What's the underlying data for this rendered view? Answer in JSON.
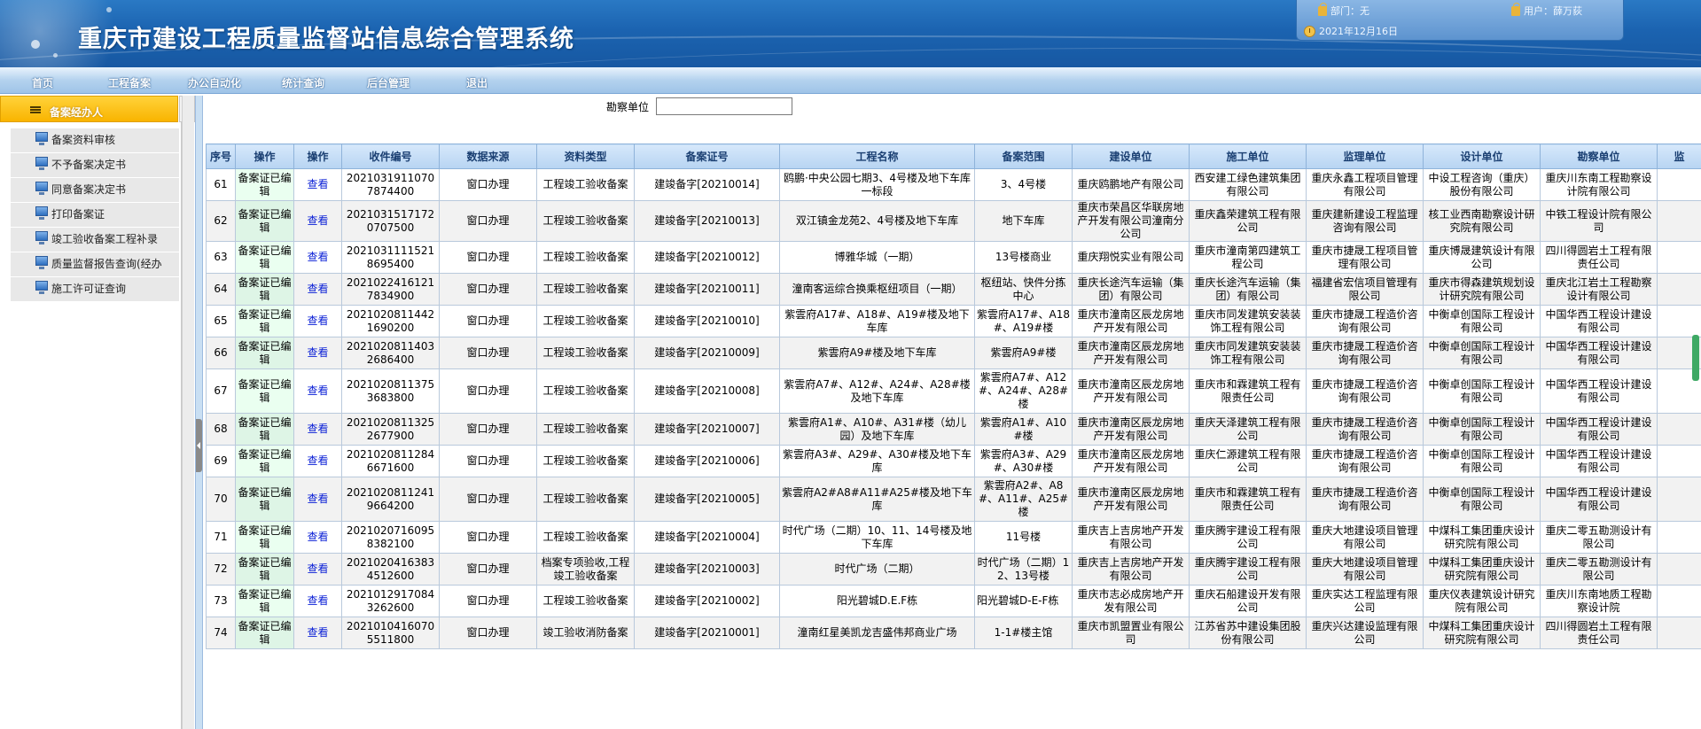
{
  "header": {
    "title": "重庆市建设工程质量监督站信息综合管理系统",
    "dept": "部门：无",
    "user": "用户：薛万荻",
    "date": "2021年12月16日"
  },
  "nav": [
    "首页",
    "工程备案",
    "办公自动化",
    "统计查询",
    "后台管理",
    "退出"
  ],
  "sidebar": {
    "header": "备案经办人",
    "items": [
      "备案资料审核",
      "不予备案决定书",
      "同意备案决定书",
      "打印备案证",
      "竣工验收备案工程补录",
      "质量监督报告查询(经办",
      "施工许可证查询"
    ]
  },
  "search": {
    "label": "勘察单位",
    "value": ""
  },
  "table": {
    "headers": [
      "序号",
      "操作",
      "操作",
      "收件编号",
      "数据来源",
      "资料类型",
      "备案证号",
      "工程名称",
      "备案范围",
      "建设单位",
      "施工单位",
      "监理单位",
      "设计单位",
      "勘察单位",
      "监"
    ],
    "rows": [
      [
        "61",
        "备案证已编辑",
        "查看",
        "20210319110707874400",
        "窗口办理",
        "工程竣工验收备案",
        "建竣备字[20210014]",
        "鸥鹏·中央公园七期3、4号楼及地下车库一标段",
        "3、4号楼",
        "重庆鸥鹏地产有限公司",
        "西安建工绿色建筑集团有限公司",
        "重庆永鑫工程项目管理有限公司",
        "中设工程咨询（重庆）股份有限公司",
        "重庆川东南工程勘察设计院有限公司"
      ],
      [
        "62",
        "备案证已编辑",
        "查看",
        "20210315171720707500",
        "窗口办理",
        "工程竣工验收备案",
        "建竣备字[20210013]",
        "双江镇金龙苑2、4号楼及地下车库",
        "地下车库",
        "重庆市荣昌区华联房地产开发有限公司潼南分公司",
        "重庆鑫荣建筑工程有限公司",
        "重庆建新建设工程监理咨询有限公司",
        "核工业西南勘察设计研究院有限公司",
        "中铁工程设计院有限公司"
      ],
      [
        "63",
        "备案证已编辑",
        "查看",
        "20210311115218695400",
        "窗口办理",
        "工程竣工验收备案",
        "建竣备字[20210012]",
        "博雅华城（一期）",
        "13号楼商业",
        "重庆翔悦实业有限公司",
        "重庆市潼南第四建筑工程公司",
        "重庆市捷晟工程项目管理有限公司",
        "重庆博晟建筑设计有限公司",
        "四川得圆岩土工程有限责任公司"
      ],
      [
        "64",
        "备案证已编辑",
        "查看",
        "20210224161217834900",
        "窗口办理",
        "工程竣工验收备案",
        "建竣备字[20210011]",
        "潼南客运综合换乘枢纽项目（一期）",
        "枢纽站、快件分拣中心",
        "重庆长途汽车运输（集团）有限公司",
        "重庆长途汽车运输（集团）有限公司",
        "福建省宏信项目管理有限公司",
        "重庆市得森建筑规划设计研究院有限公司",
        "重庆北江岩土工程勘察设计有限公司"
      ],
      [
        "65",
        "备案证已编辑",
        "查看",
        "20210208114421690200",
        "窗口办理",
        "工程竣工验收备案",
        "建竣备字[20210010]",
        "紫雲府A17#、A18#、A19#楼及地下车库",
        "紫雲府A17#、A18#、A19#楼",
        "重庆市潼南区辰龙房地产开发有限公司",
        "重庆市同发建筑安装装饰工程有限公司",
        "重庆市捷晟工程造价咨询有限公司",
        "中衡卓创国际工程设计有限公司",
        "中国华西工程设计建设有限公司"
      ],
      [
        "66",
        "备案证已编辑",
        "查看",
        "20210208114032686400",
        "窗口办理",
        "工程竣工验收备案",
        "建竣备字[20210009]",
        "紫雲府A9#楼及地下车库",
        "紫雲府A9#楼",
        "重庆市潼南区辰龙房地产开发有限公司",
        "重庆市同发建筑安装装饰工程有限公司",
        "重庆市捷晟工程造价咨询有限公司",
        "中衡卓创国际工程设计有限公司",
        "中国华西工程设计建设有限公司"
      ],
      [
        "67",
        "备案证已编辑",
        "查看",
        "20210208113753683800",
        "窗口办理",
        "工程竣工验收备案",
        "建竣备字[20210008]",
        "紫雲府A7#、A12#、A24#、A28#楼及地下车库",
        "紫雲府A7#、A12#、A24#、A28#楼",
        "重庆市潼南区辰龙房地产开发有限公司",
        "重庆市和霖建筑工程有限责任公司",
        "重庆市捷晟工程造价咨询有限公司",
        "中衡卓创国际工程设计有限公司",
        "中国华西工程设计建设有限公司"
      ],
      [
        "68",
        "备案证已编辑",
        "查看",
        "20210208113252677900",
        "窗口办理",
        "工程竣工验收备案",
        "建竣备字[20210007]",
        "紫雲府A1#、A10#、A31#楼（幼儿园）及地下车库",
        "紫雲府A1#、A10#楼",
        "重庆市潼南区辰龙房地产开发有限公司",
        "重庆天泽建筑工程有限公司",
        "重庆市捷晟工程造价咨询有限公司",
        "中衡卓创国际工程设计有限公司",
        "中国华西工程设计建设有限公司"
      ],
      [
        "69",
        "备案证已编辑",
        "查看",
        "20210208112846671600",
        "窗口办理",
        "工程竣工验收备案",
        "建竣备字[20210006]",
        "紫雲府A3#、A29#、A30#楼及地下车库",
        "紫雲府A3#、A29#、A30#楼",
        "重庆市潼南区辰龙房地产开发有限公司",
        "重庆仁源建筑工程有限公司",
        "重庆市捷晟工程造价咨询有限公司",
        "中衡卓创国际工程设计有限公司",
        "中国华西工程设计建设有限公司"
      ],
      [
        "70",
        "备案证已编辑",
        "查看",
        "20210208112419664200",
        "窗口办理",
        "工程竣工验收备案",
        "建竣备字[20210005]",
        "紫雲府A2#A8#A11#A25#楼及地下车库",
        "紫雲府A2#、A8#、A11#、A25#楼",
        "重庆市潼南区辰龙房地产开发有限公司",
        "重庆市和霖建筑工程有限责任公司",
        "重庆市捷晟工程造价咨询有限公司",
        "中衡卓创国际工程设计有限公司",
        "中国华西工程设计建设有限公司"
      ],
      [
        "71",
        "备案证已编辑",
        "查看",
        "20210207160958382100",
        "窗口办理",
        "工程竣工验收备案",
        "建竣备字[20210004]",
        "时代广场（二期）10、11、14号楼及地下车库",
        "11号楼",
        "重庆吉上吉房地产开发有限公司",
        "重庆腾宇建设工程有限公司",
        "重庆大地建设项目管理有限公司",
        "中煤科工集团重庆设计研究院有限公司",
        "重庆二零五勘测设计有限公司"
      ],
      [
        "72",
        "备案证已编辑",
        "查看",
        "20210204163834512600",
        "窗口办理",
        "档案专项验收,工程竣工验收备案",
        "建竣备字[20210003]",
        "时代广场（二期）",
        "时代广场（二期）12、13号楼",
        "重庆吉上吉房地产开发有限公司",
        "重庆腾宇建设工程有限公司",
        "重庆大地建设项目管理有限公司",
        "中煤科工集团重庆设计研究院有限公司",
        "重庆二零五勘测设计有限公司"
      ],
      [
        "73",
        "备案证已编辑",
        "查看",
        "20210129170843262600",
        "窗口办理",
        "工程竣工验收备案",
        "建竣备字[20210002]",
        "阳光碧城D.E.F栋",
        "阳光碧城D-E-F栋",
        "重庆市志必成房地产开发有限公司",
        "重庆石船建设开发有限公司",
        "重庆实达工程监理有限公司",
        "重庆仪表建筑设计研究院有限公司",
        "重庆川东南地质工程勘察设计院"
      ],
      [
        "74",
        "备案证已编辑",
        "查看",
        "20210104160705511800",
        "窗口办理",
        "竣工验收消防备案",
        "建竣备字[20210001]",
        "潼南红星美凯龙吉盛伟邦商业广场",
        "1-1#楼主馆",
        "重庆市凯盟置业有限公司",
        "江苏省苏中建设集团股份有限公司",
        "重庆兴达建设监理有限公司",
        "中煤科工集团重庆设计研究院有限公司",
        "四川得圆岩土工程有限责任公司"
      ]
    ]
  }
}
